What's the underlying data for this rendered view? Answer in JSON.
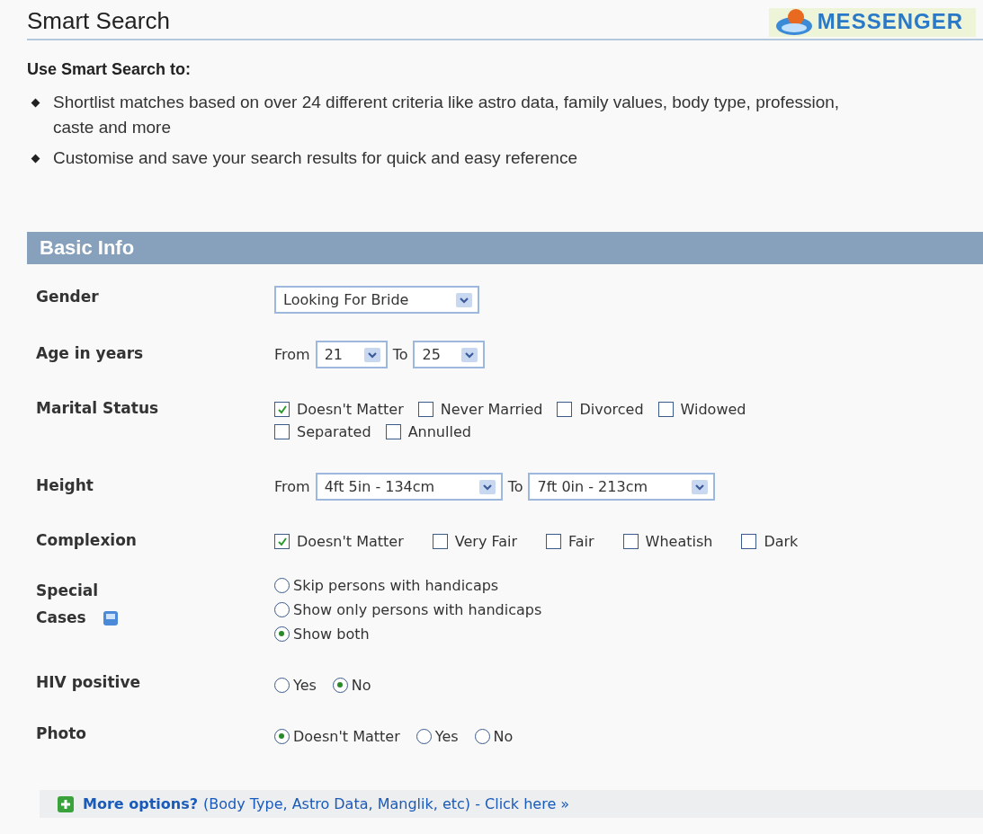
{
  "header": {
    "title": "Smart Search",
    "logo_text": "MESSENGER"
  },
  "intro": {
    "heading": "Use Smart Search to:",
    "bullets": [
      "Shortlist matches based on over 24 different criteria like astro data, family values, body type, profession, caste and more",
      "Customise and save your search results for quick and easy reference"
    ]
  },
  "section": {
    "title": "Basic Info",
    "rows": [
      {
        "label": "Gender",
        "kind": "select",
        "value": "Looking For Bride"
      },
      {
        "label": "Age in years",
        "kind": "range",
        "from_label": "From",
        "from_value": "21",
        "to_label": "To",
        "to_value": "25"
      },
      {
        "label": "Marital Status",
        "kind": "checks",
        "options": [
          {
            "label": "Doesn't Matter",
            "checked": true
          },
          {
            "label": "Never Married",
            "checked": false
          },
          {
            "label": "Divorced",
            "checked": false
          },
          {
            "label": "Widowed",
            "checked": false
          },
          {
            "label": "Separated",
            "checked": false
          },
          {
            "label": "Annulled",
            "checked": false
          }
        ]
      },
      {
        "label": "Height",
        "kind": "range",
        "from_label": "From",
        "from_value": "4ft 5in - 134cm",
        "to_label": "To",
        "to_value": "7ft 0in - 213cm"
      },
      {
        "label": "Complexion",
        "kind": "checks",
        "options": [
          {
            "label": "Doesn't Matter",
            "checked": true
          },
          {
            "label": "Very Fair",
            "checked": false
          },
          {
            "label": "Fair",
            "checked": false
          },
          {
            "label": "Wheatish",
            "checked": false
          },
          {
            "label": "Dark",
            "checked": false
          }
        ]
      },
      {
        "label": "Special Cases",
        "kind": "radios",
        "vertical": true,
        "help": true,
        "options": [
          {
            "label": "Skip persons with handicaps",
            "selected": false
          },
          {
            "label": "Show only persons with handicaps",
            "selected": false
          },
          {
            "label": "Show both",
            "selected": true
          }
        ]
      },
      {
        "label": "HIV positive",
        "kind": "radios",
        "options": [
          {
            "label": "Yes",
            "selected": false
          },
          {
            "label": "No",
            "selected": true
          }
        ]
      },
      {
        "label": "Photo",
        "kind": "radios",
        "options": [
          {
            "label": "Doesn't Matter",
            "selected": true
          },
          {
            "label": "Yes",
            "selected": false
          },
          {
            "label": "No",
            "selected": false
          }
        ]
      }
    ]
  },
  "more_options": {
    "link": "More options?",
    "text": "(Body Type, Astro Data, Manglik, etc) - Click here »"
  }
}
